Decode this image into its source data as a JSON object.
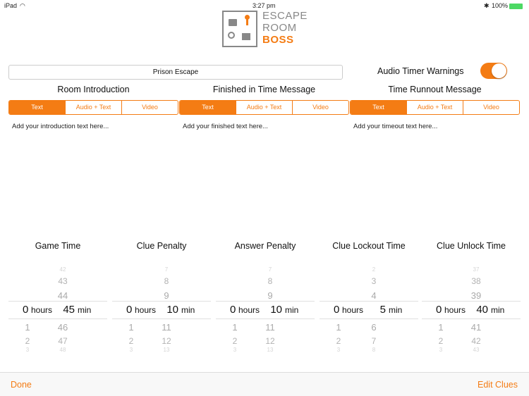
{
  "status": {
    "device": "iPad",
    "time": "3:27 pm",
    "battery": "100%"
  },
  "logo": {
    "line1": "ESCAPE",
    "line2": "ROOM",
    "line3": "BOSS"
  },
  "room_name": "Prison Escape",
  "audio_warnings": {
    "label": "Audio Timer Warnings",
    "on": true
  },
  "segments": [
    "Text",
    "Audio + Text",
    "Video"
  ],
  "sections": [
    {
      "title": "Room Introduction",
      "placeholder": "Add your introduction text here..."
    },
    {
      "title": "Finished in Time Message",
      "placeholder": "Add your finished text here..."
    },
    {
      "title": "Time Runnout Message",
      "placeholder": "Add your timeout text here..."
    }
  ],
  "pickers": [
    {
      "title": "Game Time",
      "hours": "0",
      "min": "45",
      "above": [
        "42",
        "43",
        "44"
      ],
      "below": [
        "46",
        "47",
        "48"
      ]
    },
    {
      "title": "Clue Penalty",
      "hours": "0",
      "min": "10",
      "above": [
        "7",
        "8",
        "9"
      ],
      "below": [
        "11",
        "12",
        "13"
      ]
    },
    {
      "title": "Answer Penalty",
      "hours": "0",
      "min": "10",
      "above": [
        "7",
        "8",
        "9"
      ],
      "below": [
        "11",
        "12",
        "13"
      ]
    },
    {
      "title": "Clue Lockout Time",
      "hours": "0",
      "min": "5",
      "above": [
        "2",
        "3",
        "4"
      ],
      "below": [
        "6",
        "7",
        "8"
      ]
    },
    {
      "title": "Clue Unlock Time",
      "hours": "0",
      "min": "40",
      "above": [
        "37",
        "38",
        "39"
      ],
      "below": [
        "41",
        "42",
        "43"
      ]
    }
  ],
  "hour_labels": {
    "hours": "hours",
    "min": "min",
    "below": [
      "1",
      "2",
      "3"
    ]
  },
  "bottom": {
    "done": "Done",
    "edit_clues": "Edit Clues"
  },
  "accent": "#f47c14"
}
